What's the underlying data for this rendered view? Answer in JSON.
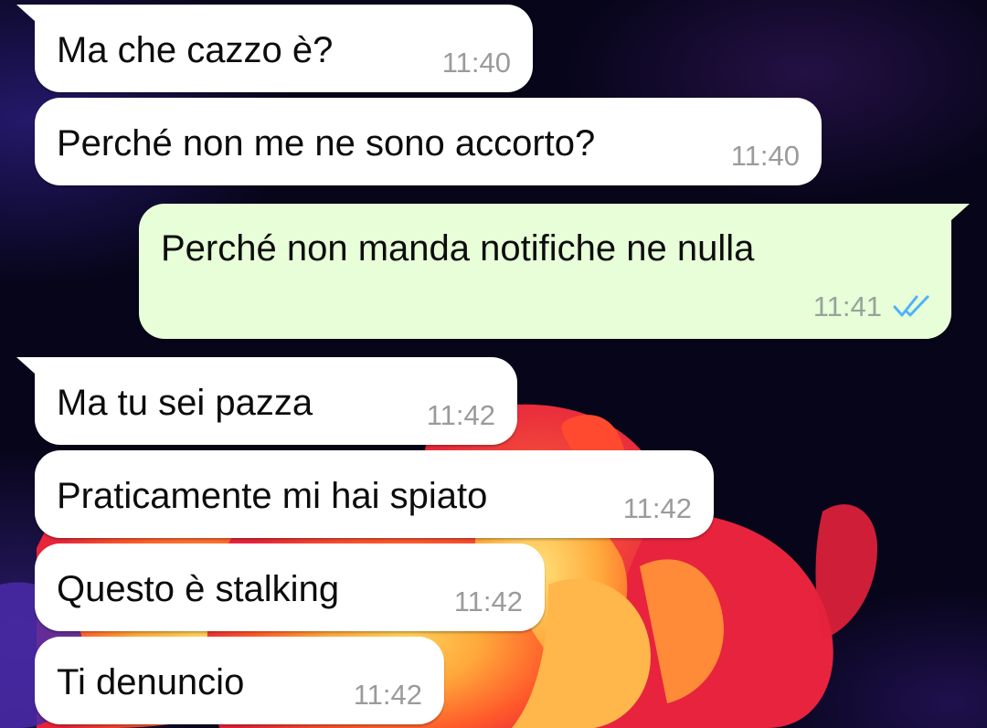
{
  "colors": {
    "incoming_bubble": "#ffffff",
    "outgoing_bubble": "#e7fed8",
    "read_ticks": "#4fb3f5",
    "timestamp": "#9b9b9b"
  },
  "messages": [
    {
      "direction": "incoming",
      "text": "Ma che cazzo è?",
      "time": "11:40"
    },
    {
      "direction": "incoming",
      "text": "Perché non me ne sono accorto?",
      "time": "11:40"
    },
    {
      "direction": "outgoing",
      "text": "Perché non manda notifiche ne nulla",
      "time": "11:41",
      "status": "read",
      "status_icon": "double-check-icon"
    },
    {
      "direction": "incoming",
      "text": "Ma tu sei pazza",
      "time": "11:42"
    },
    {
      "direction": "incoming",
      "text": "Praticamente mi hai spiato",
      "time": "11:42"
    },
    {
      "direction": "incoming",
      "text": "Questo è stalking",
      "time": "11:42"
    },
    {
      "direction": "incoming",
      "text": "Ti denuncio",
      "time": "11:42"
    }
  ]
}
